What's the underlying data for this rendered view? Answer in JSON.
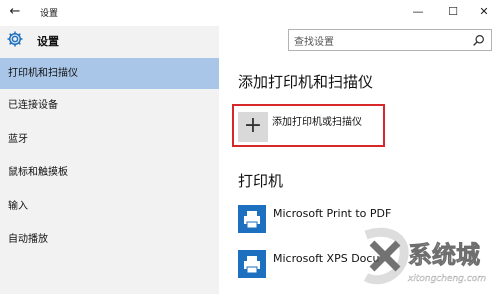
{
  "window": {
    "title": "设置",
    "back_glyph": "←",
    "min_glyph": "—",
    "max_glyph": "☐",
    "close_glyph": "✕"
  },
  "sidebar": {
    "title": "设置",
    "items": [
      {
        "label": "打印机和扫描仪",
        "active": true
      },
      {
        "label": "已连接设备",
        "active": false
      },
      {
        "label": "蓝牙",
        "active": false
      },
      {
        "label": "鼠标和触摸板",
        "active": false
      },
      {
        "label": "输入",
        "active": false
      },
      {
        "label": "自动播放",
        "active": false
      }
    ]
  },
  "search": {
    "placeholder": "查找设置",
    "icon": "search-icon"
  },
  "main": {
    "add_heading": "添加打印机和扫描仪",
    "add_button_label": "添加打印机或扫描仪",
    "add_button_glyph": "+",
    "printers_heading": "打印机",
    "printers": [
      {
        "name": "Microsoft Print to PDF"
      },
      {
        "name": "Microsoft XPS Docu"
      }
    ]
  },
  "watermark": {
    "text": "系统城",
    "url": "xitongcheng.com"
  },
  "colors": {
    "sidebar_bg": "#f2f2f2",
    "active_item": "#a9c6e8",
    "highlight_border": "#d62828",
    "printer_icon": "#1d6fbf"
  }
}
